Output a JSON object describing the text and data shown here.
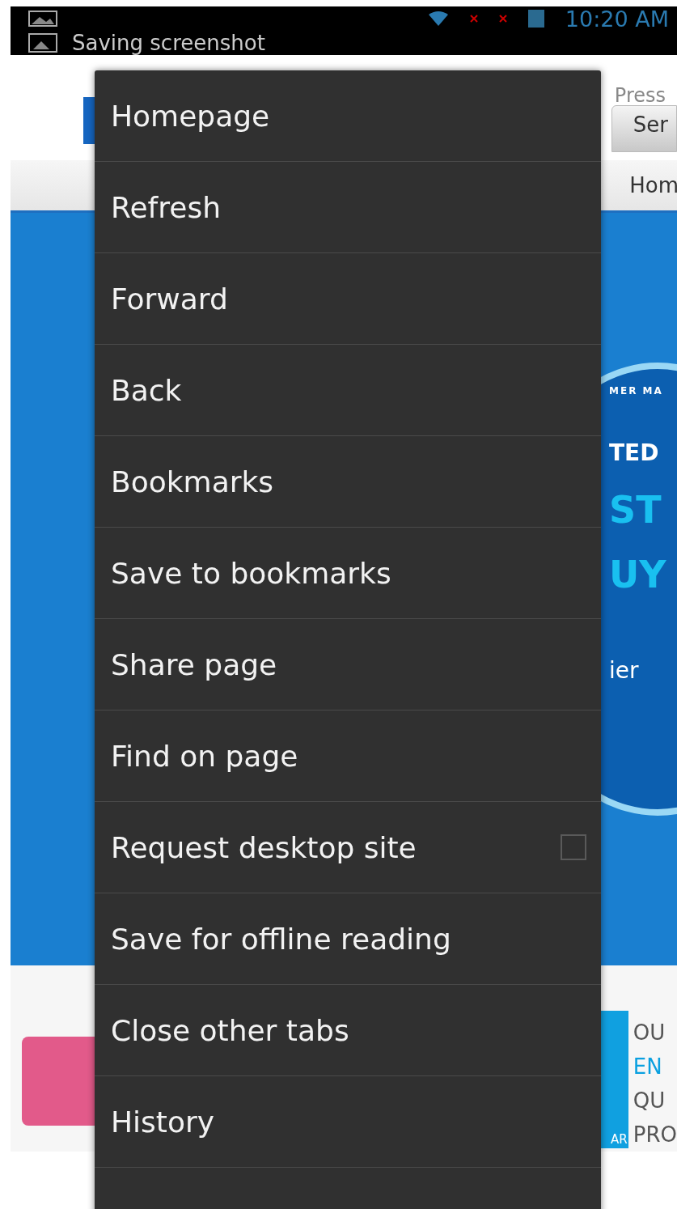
{
  "status_bar": {
    "time": "10:20 AM",
    "notification": "Saving screenshot"
  },
  "page": {
    "header_link": "Press",
    "tab": "Ser",
    "nav_item": "Hom",
    "banner": {
      "arc_text": "MER MA",
      "lines": [
        "TED",
        "ST",
        "UY"
      ],
      "footer": "ier"
    },
    "promo": {
      "badge": "AR",
      "lines": [
        {
          "text": "OU",
          "color": "#555555"
        },
        {
          "text": "EN",
          "color": "#0aa0e0"
        },
        {
          "text": "QU",
          "color": "#555555"
        },
        {
          "text": "PRO",
          "color": "#555555"
        }
      ]
    }
  },
  "menu": {
    "items": [
      {
        "kind": "plain",
        "label": "Homepage"
      },
      {
        "kind": "plain",
        "label": "Refresh"
      },
      {
        "kind": "plain",
        "label": "Forward"
      },
      {
        "kind": "plain",
        "label": "Back"
      },
      {
        "kind": "plain",
        "label": "Bookmarks"
      },
      {
        "kind": "plain",
        "label": "Save to bookmarks"
      },
      {
        "kind": "plain",
        "label": "Share page"
      },
      {
        "kind": "plain",
        "label": "Find on page"
      },
      {
        "kind": "checkbox",
        "label": "Request desktop site",
        "checked": false
      },
      {
        "kind": "plain",
        "label": "Save for offline reading"
      },
      {
        "kind": "plain",
        "label": "Close other tabs"
      },
      {
        "kind": "plain",
        "label": "History"
      }
    ]
  }
}
